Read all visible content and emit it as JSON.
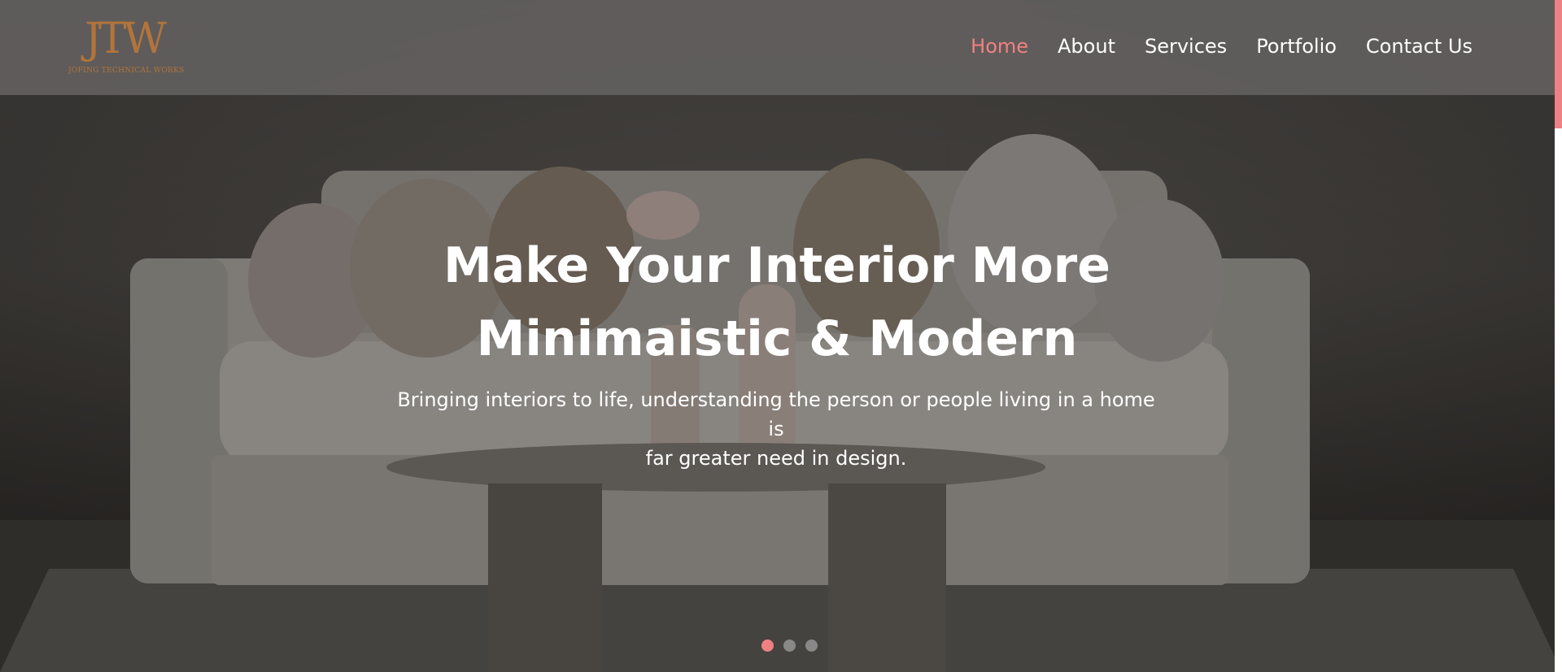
{
  "brand": {
    "logo_mark": "JTW",
    "logo_text": "JOFING TECHNICAL WORKS",
    "accent_color": "#f08182",
    "logo_color": "#b2743c"
  },
  "nav": {
    "items": [
      {
        "label": "Home",
        "active": true
      },
      {
        "label": "About",
        "active": false
      },
      {
        "label": "Services",
        "active": false
      },
      {
        "label": "Portfolio",
        "active": false
      },
      {
        "label": "Contact Us",
        "active": false
      }
    ]
  },
  "hero": {
    "title_line1": "Make Your Interior More",
    "title_line2": "Minimaistic & Modern",
    "subtitle_line1": "Bringing interiors to life, understanding the person or people living in a home is",
    "subtitle_line2": "far greater need in design.",
    "background_image": "sofa-living-room-photo"
  },
  "slider": {
    "slide_count": 3,
    "active_index": 0
  }
}
